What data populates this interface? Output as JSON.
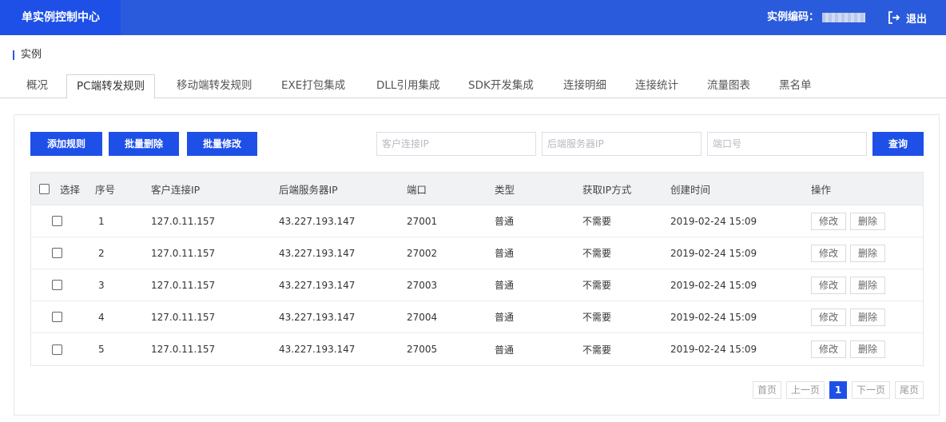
{
  "header": {
    "brand": "单实例控制中心",
    "instance_code_label": "实例编码：",
    "logout_label": "退出"
  },
  "breadcrumb": {
    "label": "实例"
  },
  "tabs": [
    {
      "label": "概况"
    },
    {
      "label": "PC端转发规则",
      "active": true
    },
    {
      "label": "移动端转发规则"
    },
    {
      "label": "EXE打包集成"
    },
    {
      "label": "DLL引用集成"
    },
    {
      "label": "SDK开发集成"
    },
    {
      "label": "连接明细"
    },
    {
      "label": "连接统计"
    },
    {
      "label": "流量图表"
    },
    {
      "label": "黑名单"
    }
  ],
  "toolbar": {
    "add_rule": "添加规则",
    "batch_delete": "批量删除",
    "batch_edit": "批量修改",
    "query": "查询"
  },
  "filters": {
    "client_ip_placeholder": "客户连接IP",
    "backend_ip_placeholder": "后端服务器IP",
    "port_placeholder": "端口号"
  },
  "table": {
    "headers": {
      "select": "选择",
      "index": "序号",
      "client_ip": "客户连接IP",
      "backend_ip": "后端服务器IP",
      "port": "端口",
      "type": "类型",
      "ip_method": "获取IP方式",
      "created": "创建时间",
      "actions": "操作"
    },
    "rows": [
      {
        "index": "1",
        "client_ip": "127.0.11.157",
        "backend_ip": "43.227.193.147",
        "port": "27001",
        "type": "普通",
        "ip_method": "不需要",
        "created": "2019-02-24 15:09"
      },
      {
        "index": "2",
        "client_ip": "127.0.11.157",
        "backend_ip": "43.227.193.147",
        "port": "27002",
        "type": "普通",
        "ip_method": "不需要",
        "created": "2019-02-24 15:09"
      },
      {
        "index": "3",
        "client_ip": "127.0.11.157",
        "backend_ip": "43.227.193.147",
        "port": "27003",
        "type": "普通",
        "ip_method": "不需要",
        "created": "2019-02-24 15:09"
      },
      {
        "index": "4",
        "client_ip": "127.0.11.157",
        "backend_ip": "43.227.193.147",
        "port": "27004",
        "type": "普通",
        "ip_method": "不需要",
        "created": "2019-02-24 15:09"
      },
      {
        "index": "5",
        "client_ip": "127.0.11.157",
        "backend_ip": "43.227.193.147",
        "port": "27005",
        "type": "普通",
        "ip_method": "不需要",
        "created": "2019-02-24 15:09"
      }
    ],
    "edit_label": "修改",
    "delete_label": "删除"
  },
  "pagination": {
    "first": "首页",
    "prev": "上一页",
    "current": "1",
    "next": "下一页",
    "last": "尾页"
  },
  "colors": {
    "primary": "#1e50e8",
    "topbar": "#2a5bdc"
  }
}
